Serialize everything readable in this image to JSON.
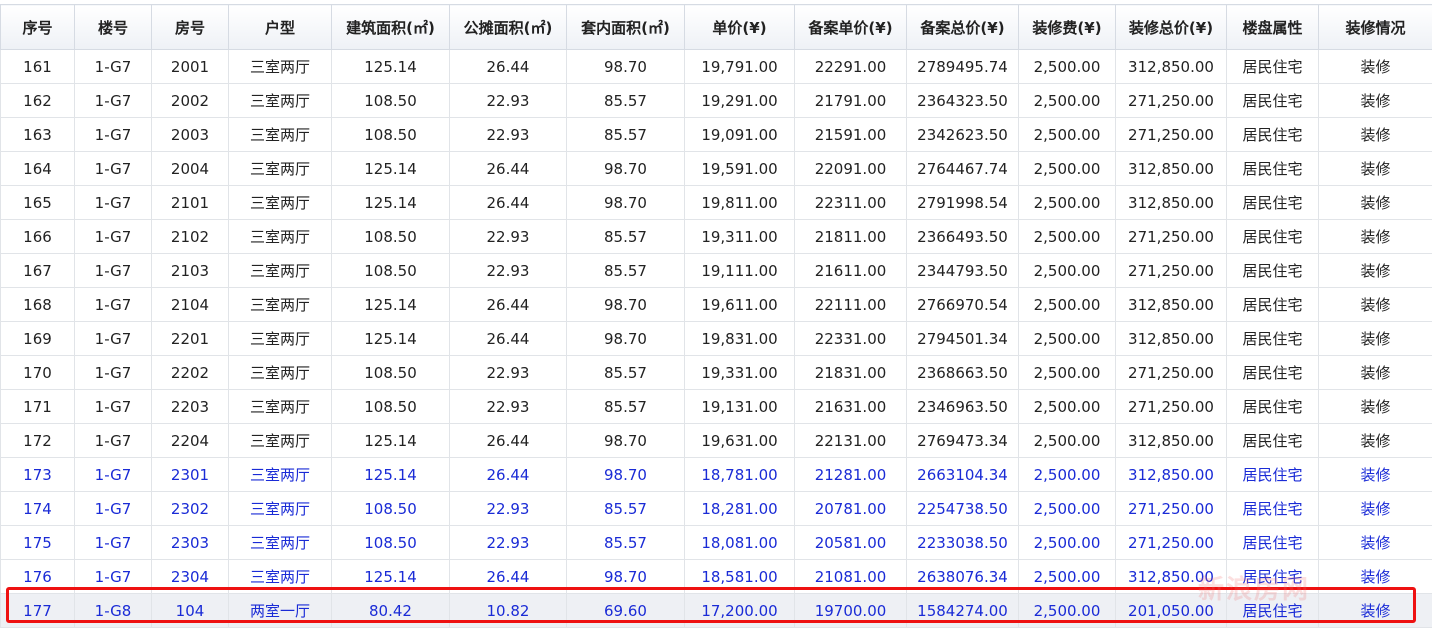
{
  "columns": [
    "序号",
    "楼号",
    "房号",
    "户型",
    "建筑面积(㎡)",
    "公摊面积(㎡)",
    "套内面积(㎡)",
    "单价(¥)",
    "备案单价(¥)",
    "备案总价(¥)",
    "装修费(¥)",
    "装修总价(¥)",
    "楼盘属性",
    "装修情况"
  ],
  "rows": [
    [
      "161",
      "1-G7",
      "2001",
      "三室两厅",
      "125.14",
      "26.44",
      "98.70",
      "19,791.00",
      "22291.00",
      "2789495.74",
      "2,500.00",
      "312,850.00",
      "居民住宅",
      "装修"
    ],
    [
      "162",
      "1-G7",
      "2002",
      "三室两厅",
      "108.50",
      "22.93",
      "85.57",
      "19,291.00",
      "21791.00",
      "2364323.50",
      "2,500.00",
      "271,250.00",
      "居民住宅",
      "装修"
    ],
    [
      "163",
      "1-G7",
      "2003",
      "三室两厅",
      "108.50",
      "22.93",
      "85.57",
      "19,091.00",
      "21591.00",
      "2342623.50",
      "2,500.00",
      "271,250.00",
      "居民住宅",
      "装修"
    ],
    [
      "164",
      "1-G7",
      "2004",
      "三室两厅",
      "125.14",
      "26.44",
      "98.70",
      "19,591.00",
      "22091.00",
      "2764467.74",
      "2,500.00",
      "312,850.00",
      "居民住宅",
      "装修"
    ],
    [
      "165",
      "1-G7",
      "2101",
      "三室两厅",
      "125.14",
      "26.44",
      "98.70",
      "19,811.00",
      "22311.00",
      "2791998.54",
      "2,500.00",
      "312,850.00",
      "居民住宅",
      "装修"
    ],
    [
      "166",
      "1-G7",
      "2102",
      "三室两厅",
      "108.50",
      "22.93",
      "85.57",
      "19,311.00",
      "21811.00",
      "2366493.50",
      "2,500.00",
      "271,250.00",
      "居民住宅",
      "装修"
    ],
    [
      "167",
      "1-G7",
      "2103",
      "三室两厅",
      "108.50",
      "22.93",
      "85.57",
      "19,111.00",
      "21611.00",
      "2344793.50",
      "2,500.00",
      "271,250.00",
      "居民住宅",
      "装修"
    ],
    [
      "168",
      "1-G7",
      "2104",
      "三室两厅",
      "125.14",
      "26.44",
      "98.70",
      "19,611.00",
      "22111.00",
      "2766970.54",
      "2,500.00",
      "312,850.00",
      "居民住宅",
      "装修"
    ],
    [
      "169",
      "1-G7",
      "2201",
      "三室两厅",
      "125.14",
      "26.44",
      "98.70",
      "19,831.00",
      "22331.00",
      "2794501.34",
      "2,500.00",
      "312,850.00",
      "居民住宅",
      "装修"
    ],
    [
      "170",
      "1-G7",
      "2202",
      "三室两厅",
      "108.50",
      "22.93",
      "85.57",
      "19,331.00",
      "21831.00",
      "2368663.50",
      "2,500.00",
      "271,250.00",
      "居民住宅",
      "装修"
    ],
    [
      "171",
      "1-G7",
      "2203",
      "三室两厅",
      "108.50",
      "22.93",
      "85.57",
      "19,131.00",
      "21631.00",
      "2346963.50",
      "2,500.00",
      "271,250.00",
      "居民住宅",
      "装修"
    ],
    [
      "172",
      "1-G7",
      "2204",
      "三室两厅",
      "125.14",
      "26.44",
      "98.70",
      "19,631.00",
      "22131.00",
      "2769473.34",
      "2,500.00",
      "312,850.00",
      "居民住宅",
      "装修"
    ],
    [
      "173",
      "1-G7",
      "2301",
      "三室两厅",
      "125.14",
      "26.44",
      "98.70",
      "18,781.00",
      "21281.00",
      "2663104.34",
      "2,500.00",
      "312,850.00",
      "居民住宅",
      "装修"
    ],
    [
      "174",
      "1-G7",
      "2302",
      "三室两厅",
      "108.50",
      "22.93",
      "85.57",
      "18,281.00",
      "20781.00",
      "2254738.50",
      "2,500.00",
      "271,250.00",
      "居民住宅",
      "装修"
    ],
    [
      "175",
      "1-G7",
      "2303",
      "三室两厅",
      "108.50",
      "22.93",
      "85.57",
      "18,081.00",
      "20581.00",
      "2233038.50",
      "2,500.00",
      "271,250.00",
      "居民住宅",
      "装修"
    ],
    [
      "176",
      "1-G7",
      "2304",
      "三室两厅",
      "125.14",
      "26.44",
      "98.70",
      "18,581.00",
      "21081.00",
      "2638076.34",
      "2,500.00",
      "312,850.00",
      "居民住宅",
      "装修"
    ],
    [
      "177",
      "1-G8",
      "104",
      "两室一厅",
      "80.42",
      "10.82",
      "69.60",
      "17,200.00",
      "19700.00",
      "1584274.00",
      "2,500.00",
      "201,050.00",
      "居民住宅",
      "装修"
    ]
  ],
  "colors": {
    "normal_text": "#222222",
    "blue_text": "#1a2bd6",
    "highlight_outline": "#ee1111"
  }
}
